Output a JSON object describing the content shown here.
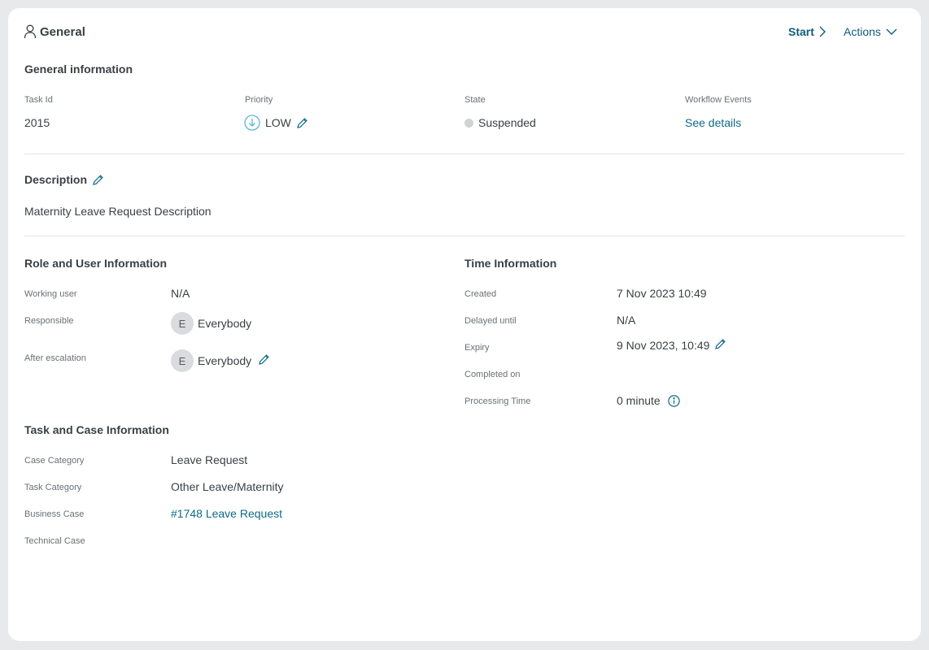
{
  "header": {
    "title": "General",
    "user_icon": "user-icon",
    "start_label": "Start",
    "actions_label": "Actions"
  },
  "general": {
    "title": "General information",
    "task_id_label": "Task Id",
    "task_id": "2015",
    "priority_label": "Priority",
    "priority": "LOW",
    "priority_icon": "arrow-down-circle-icon",
    "state_label": "State",
    "state": "Suspended",
    "workflow_label": "Workflow Events",
    "workflow_link": "See details"
  },
  "description": {
    "title": "Description",
    "text": "Maternity Leave Request Description"
  },
  "role": {
    "title": "Role and User Information",
    "working_user_label": "Working user",
    "working_user": "N/A",
    "responsible_label": "Responsible",
    "responsible_initial": "E",
    "responsible": "Everybody",
    "after_escalation_label": "After escalation",
    "after_escalation_initial": "E",
    "after_escalation": "Everybody"
  },
  "time": {
    "title": "Time Information",
    "created_label": "Created",
    "created": "7 Nov 2023 10:49",
    "delayed_label": "Delayed until",
    "delayed": "N/A",
    "expiry_label": "Expiry",
    "expiry": "9 Nov 2023, 10:49",
    "completed_label": "Completed on",
    "processing_label": "Processing Time",
    "processing": "0 minute"
  },
  "task_case": {
    "title": "Task and Case Information",
    "case_category_label": "Case Category",
    "case_category": "Leave Request",
    "task_category_label": "Task Category",
    "task_category": "Other Leave/Maternity",
    "business_case_label": "Business Case",
    "business_case": "#1748 Leave Request",
    "technical_case_label": "Technical Case"
  },
  "colors": {
    "accent": "#0f5c7a",
    "link": "#0f6a88",
    "priority_low": "#5bb8d6",
    "state_suspended": "#d0d2d4"
  }
}
